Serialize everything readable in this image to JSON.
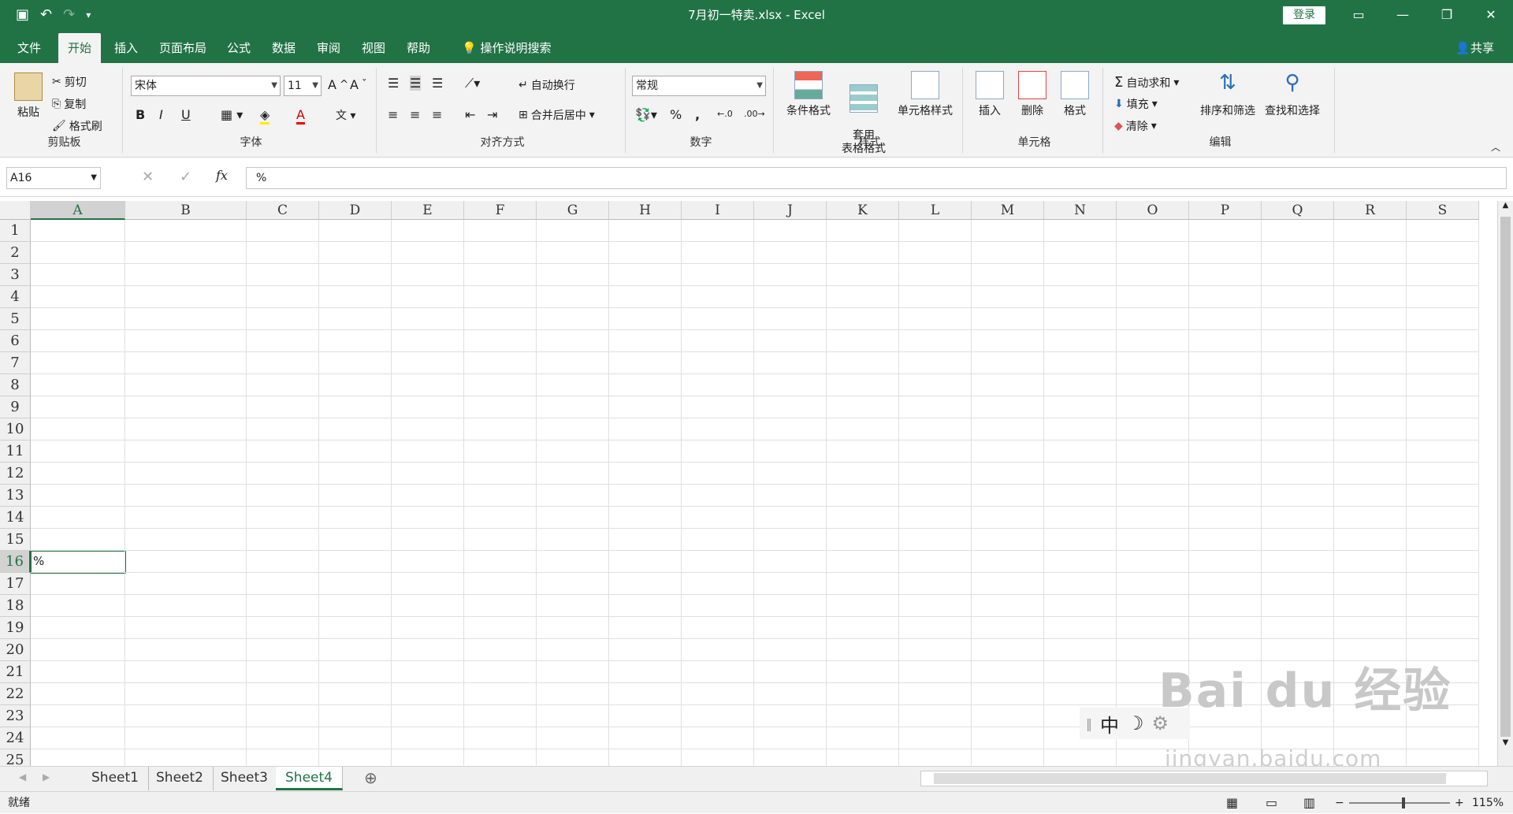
{
  "window": {
    "title": "7月初一特卖.xlsx  -  Excel",
    "login": "登录"
  },
  "qat": {
    "save": "💾",
    "undo": "↶",
    "redo": "↷",
    "more": "▾"
  },
  "tabs": [
    "文件",
    "开始",
    "插入",
    "页面布局",
    "公式",
    "数据",
    "审阅",
    "视图",
    "帮助"
  ],
  "tell_me": "操作说明搜索",
  "share": "共享",
  "ribbon": {
    "clipboard": {
      "label": "剪贴板",
      "paste": "粘贴",
      "cut": "剪切",
      "copy": "复制",
      "format_painter": "格式刷"
    },
    "font": {
      "label": "字体",
      "font_name": "宋体",
      "font_size": "11",
      "bold": "B",
      "italic": "I",
      "underline": "U"
    },
    "alignment": {
      "label": "对齐方式",
      "wrap": "自动换行",
      "merge": "合并后居中"
    },
    "number": {
      "label": "数字",
      "format": "常规",
      "percent": "%",
      "comma": ","
    },
    "styles": {
      "label": "样式",
      "cond": "条件格式",
      "table": "套用\n表格格式",
      "cell": "单元格样式"
    },
    "cells": {
      "label": "单元格",
      "insert": "插入",
      "delete": "删除",
      "format": "格式"
    },
    "editing": {
      "label": "编辑",
      "autosum": "自动求和",
      "fill": "填充",
      "clear": "清除",
      "sort": "排序和筛选",
      "find": "查找和选择"
    }
  },
  "formula_bar": {
    "name_box": "A16",
    "fx": "fx",
    "formula": "%"
  },
  "columns": [
    "A",
    "B",
    "C",
    "D",
    "E",
    "F",
    "G",
    "H",
    "I",
    "J",
    "K",
    "L",
    "M",
    "N",
    "O",
    "P",
    "Q",
    "R",
    "S"
  ],
  "rows": [
    "1",
    "2",
    "3",
    "4",
    "5",
    "6",
    "7",
    "8",
    "9",
    "10",
    "11",
    "12",
    "13",
    "14",
    "15",
    "16",
    "17",
    "18",
    "19",
    "20",
    "21",
    "22",
    "23",
    "24",
    "25"
  ],
  "active_cell": {
    "ref": "A16",
    "value": "%"
  },
  "sheets": [
    "Sheet1",
    "Sheet2",
    "Sheet3",
    "Sheet4"
  ],
  "active_sheet": "Sheet4",
  "status": {
    "mode": "就绪",
    "zoom": "115%"
  },
  "ime": {
    "mode": "中"
  },
  "watermark": {
    "main": "Bai du 经验",
    "sub": "jingyan.baidu.com"
  }
}
